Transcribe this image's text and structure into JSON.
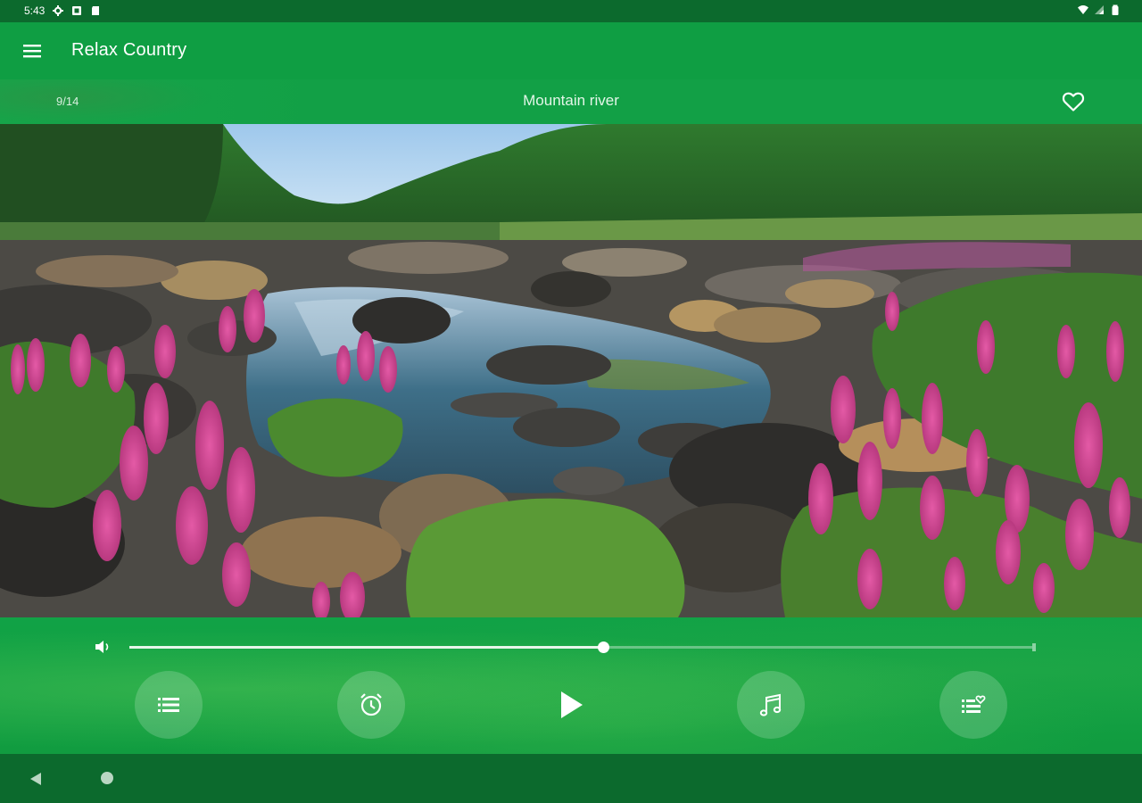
{
  "status_bar": {
    "time": "5:43",
    "left_icons": [
      "settings-icon",
      "media-icon",
      "sd-card-icon"
    ],
    "right_icons": [
      "wifi-icon",
      "signal-icon",
      "battery-icon"
    ]
  },
  "app_bar": {
    "title": "Relax Country",
    "menu_icon": "hamburger-menu-icon"
  },
  "track_header": {
    "position": "9/14",
    "title": "Mountain river",
    "favorite_icon": "heart-outline-icon"
  },
  "scene": {
    "description_icon": "landscape-image"
  },
  "player": {
    "volume_icon": "volume-icon",
    "volume_level": 0.525,
    "buttons": [
      {
        "id": "playlist",
        "icon": "list-icon"
      },
      {
        "id": "timer",
        "icon": "alarm-clock-icon"
      },
      {
        "id": "play",
        "icon": "play-icon"
      },
      {
        "id": "music",
        "icon": "music-note-icon"
      },
      {
        "id": "favorites",
        "icon": "favorites-list-icon"
      }
    ]
  },
  "colors": {
    "status_bar": "#0c6a2d",
    "app_bar": "#0f9e43",
    "accent": "#12a046"
  },
  "nav_bar": {
    "back_icon": "back-triangle-icon",
    "home_icon": "home-circle-icon"
  }
}
